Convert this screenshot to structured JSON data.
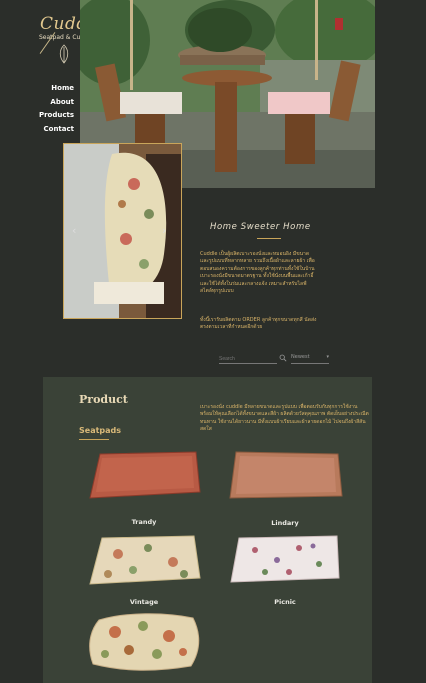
{
  "brand": {
    "name": "Cuddle",
    "tagline": "Seatpad & Cushion"
  },
  "nav": [
    "Home",
    "About",
    "Products",
    "Contact"
  ],
  "hero_alt": "garden seating with bonsai",
  "section_title": "Home Sweeter Home",
  "intro": [
    "Cuddle เป็นผู้ผลิตเบาะรองนั่งและหมอนอิง มีขนาดและรูปแบบที่หลากหลาย รวมถึงเนื้อผ้าและลายผ้า เพื่อตอบสนองความต้องการของลูกค้าทุกท่านทั้งใช้ในบ้าน เบาะรองนั่งมีขนาดมาตรฐาน ทั้งใช้นั่งบนพื้นและเก้าอี้ และใช้ได้ทั้งในร่มและกลางแจ้ง เหมาะสำหรับไลฟ์สไตล์ทุกรูปแบบ",
    "ทั้งนี้เรารับผลิตตาม ORDER ลูกค้าทุกขนาดทุกสี นัดส่งตรงตามเวลาที่กำหนดอีกด้วย"
  ],
  "search": {
    "placeholder": "Search",
    "sort": "Newest"
  },
  "products": {
    "title": "Product",
    "category": "Seatpads",
    "description": "เบาะรองนั่ง cuddle มีหลายขนาดและรูปแบบ เพื่อตอบรับกับทุกการใช้งาน พร้อมให้คุณเลือกได้ทั้งขนาดและสีผ้า ผลิตด้วยวัสดุคุณภาพ ตัดเย็บอย่างประณีต ทนทาน ใช้งานได้ยาวนาน มีทั้งแบบผ้าเรียบและผ้าลายดอกไม้ ไปจนถึงผ้าสีสันสดใส",
    "items": [
      {
        "name": "Trandy",
        "color": "#b85a44"
      },
      {
        "name": "Lindary",
        "color": "#b87a5c"
      },
      {
        "name": "Vintage",
        "color": "#e6d8ba"
      },
      {
        "name": "Picnic",
        "color": "#eee7e6"
      },
      {
        "name": "",
        "color": "#e4d6b2"
      }
    ]
  }
}
